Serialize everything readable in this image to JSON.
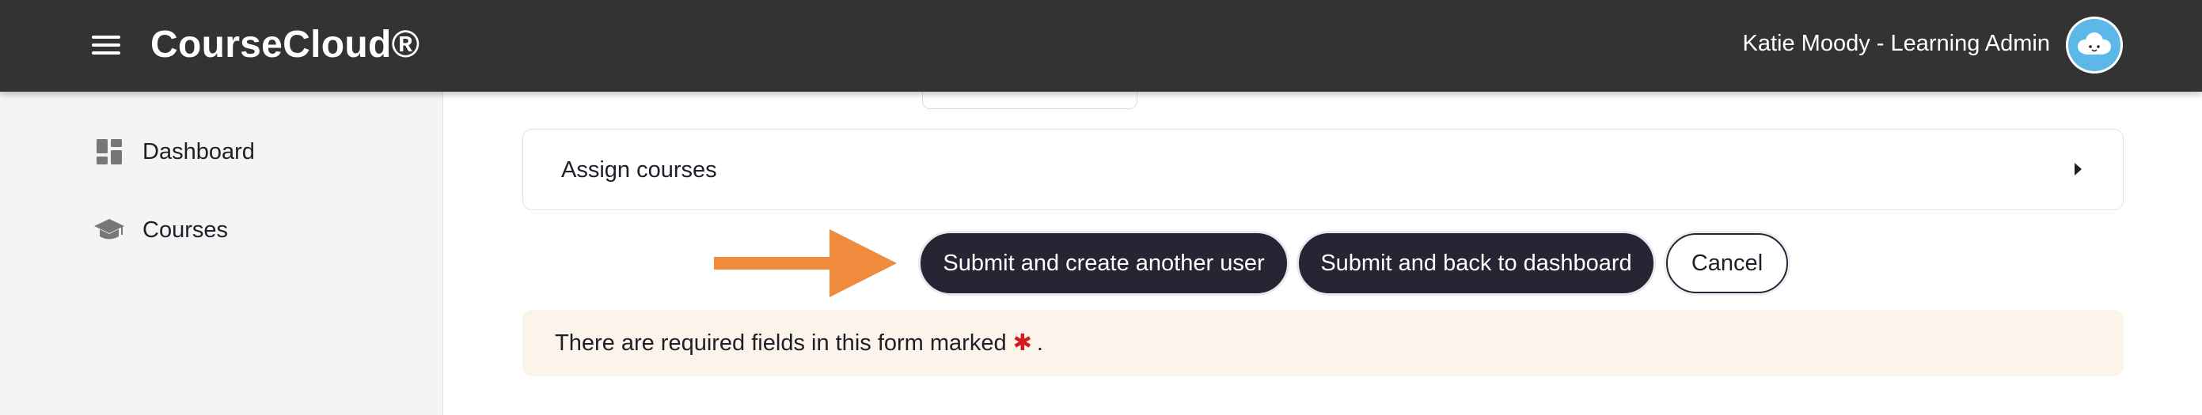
{
  "header": {
    "brand": "CourseCloud®",
    "user_name": "Katie Moody - Learning Admin",
    "menu_icon": "hamburger-menu-icon",
    "avatar_icon": "cloud-avatar-icon"
  },
  "sidebar": {
    "items": [
      {
        "label": "Dashboard",
        "icon": "dashboard-grid-icon"
      },
      {
        "label": "Courses",
        "icon": "graduation-cap-icon"
      }
    ]
  },
  "form": {
    "assign_courses_label": "Assign courses",
    "buttons": {
      "submit_create_another": "Submit and create another user",
      "submit_back_dashboard": "Submit and back to dashboard",
      "cancel": "Cancel"
    },
    "notice_text": "There are required fields in this form marked",
    "required_marker": "✱",
    "notice_end": "."
  },
  "colors": {
    "header_bg": "#333333",
    "sidebar_bg": "#f4f4f4",
    "button_dark": "#252533",
    "notice_bg": "#fcf4ea",
    "arrow": "#f08a3c",
    "required": "#d11d1d"
  }
}
